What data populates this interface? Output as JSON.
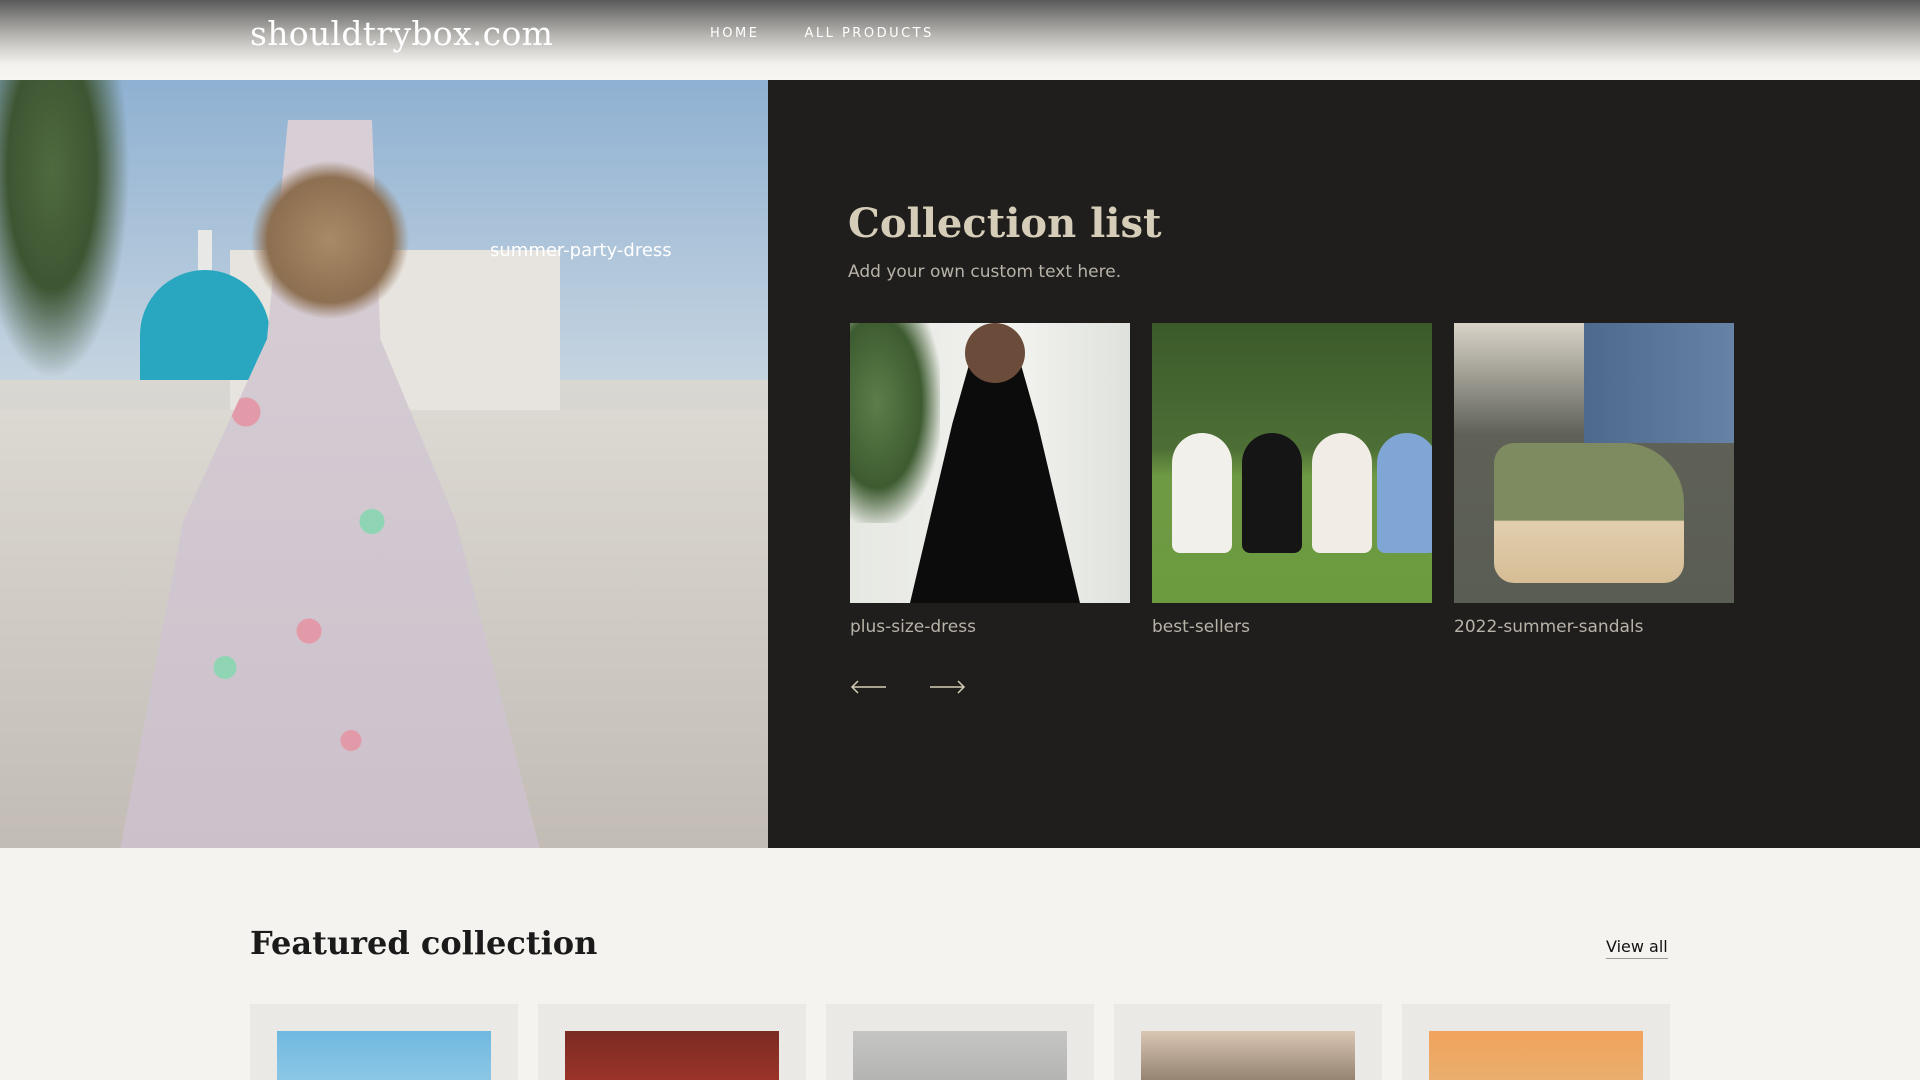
{
  "header": {
    "logo": "shouldtrybox.com",
    "nav": [
      "HOME",
      "ALL PRODUCTS"
    ]
  },
  "hero": {
    "image_label": "summer-party-dress",
    "title": "Collection list",
    "subtitle": "Add your own custom text here.",
    "collections": [
      {
        "label": "plus-size-dress"
      },
      {
        "label": "best-sellers"
      },
      {
        "label": "2022-summer-sandals"
      }
    ],
    "arrows": {
      "prev_icon": "arrow-left-icon",
      "next_icon": "arrow-right-icon"
    }
  },
  "featured": {
    "title": "Featured collection",
    "view_all": "View all",
    "product_count": 5
  },
  "colors": {
    "panel_bg": "#1f1e1d",
    "panel_title": "#d6cdb8",
    "page_bg": "#f5f3ef"
  }
}
